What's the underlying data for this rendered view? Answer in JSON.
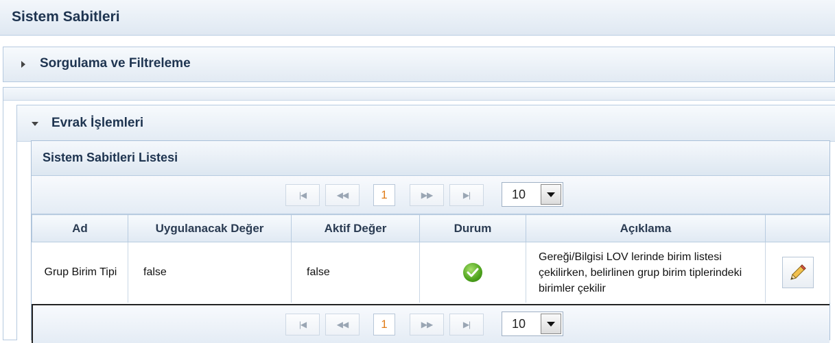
{
  "page": {
    "title": "Sistem Sabitleri"
  },
  "filter_panel": {
    "label": "Sorgulama ve Filtreleme"
  },
  "evrak_panel": {
    "label": "Evrak İşlemleri"
  },
  "list": {
    "title": "Sistem Sabitleri Listesi",
    "pager": {
      "first": "|◀",
      "prev": "◀◀",
      "current_page": "1",
      "next": "▶▶",
      "last": "▶|",
      "page_size": "10"
    },
    "columns": [
      "Ad",
      "Uygulanacak Değer",
      "Aktif Değer",
      "Durum",
      "Açıklama",
      ""
    ],
    "rows": [
      {
        "ad": "Grup Birim Tipi",
        "uygulanacak_deger": "false",
        "aktif_deger": "false",
        "durum_icon": "check-circle-green",
        "aciklama": "Gereği/Bilgisi LOV lerinde birim listesi çekilirken, belirlinen grup birim tiplerindeki birimler çekilir",
        "action_icon": "edit-pencil"
      }
    ]
  },
  "colors": {
    "header_text": "#1e3450",
    "page_accent": "#e07b16",
    "status_ok": "#4da21c"
  }
}
